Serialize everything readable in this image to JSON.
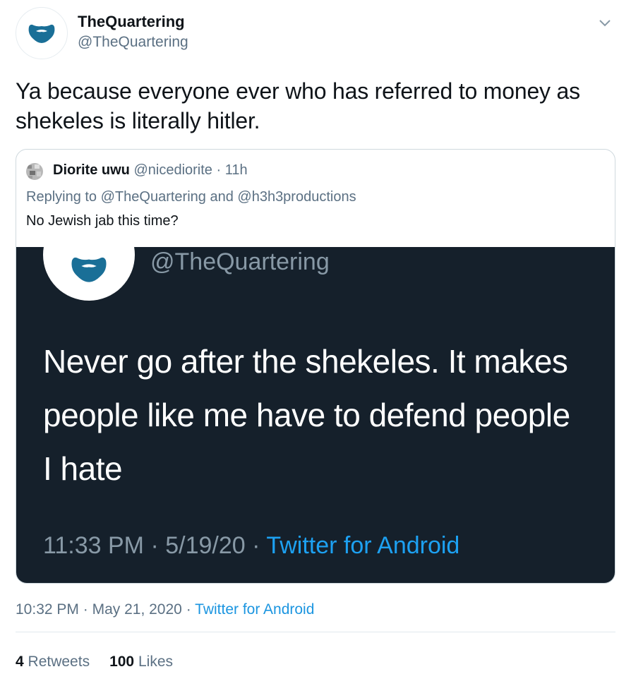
{
  "tweet": {
    "display_name": "TheQuartering",
    "handle": "@TheQuartering",
    "text": "Ya because everyone ever who has referred to money as shekeles is literally hitler.",
    "time": "10:32 PM",
    "date": "May 21, 2020",
    "source": "Twitter for Android",
    "retweets_count": "4",
    "retweets_label": "Retweets",
    "likes_count": "100",
    "likes_label": "Likes",
    "icons": {
      "avatar": "beard-logo-icon",
      "menu": "chevron-down-icon"
    }
  },
  "quoted_tweet": {
    "display_name": "Diorite uwu",
    "handle": "@nicediorite",
    "age": "11h",
    "replying_prefix": "Replying to",
    "reply_mention_1": "@TheQuartering",
    "reply_and": "and",
    "reply_mention_2": "@h3h3productions",
    "text": "No Jewish jab this time?",
    "image": {
      "handle": "@TheQuartering",
      "text": "Never go after the shekeles. It makes people like me have to defend people I hate",
      "time": "11:33 PM",
      "date": "5/19/20",
      "source": "Twitter for Android"
    }
  },
  "colors": {
    "text": "#0f1419",
    "secondary": "#5b7083",
    "link": "#1b95e0",
    "image_bg": "#15202b",
    "logo": "#1a6f97"
  }
}
